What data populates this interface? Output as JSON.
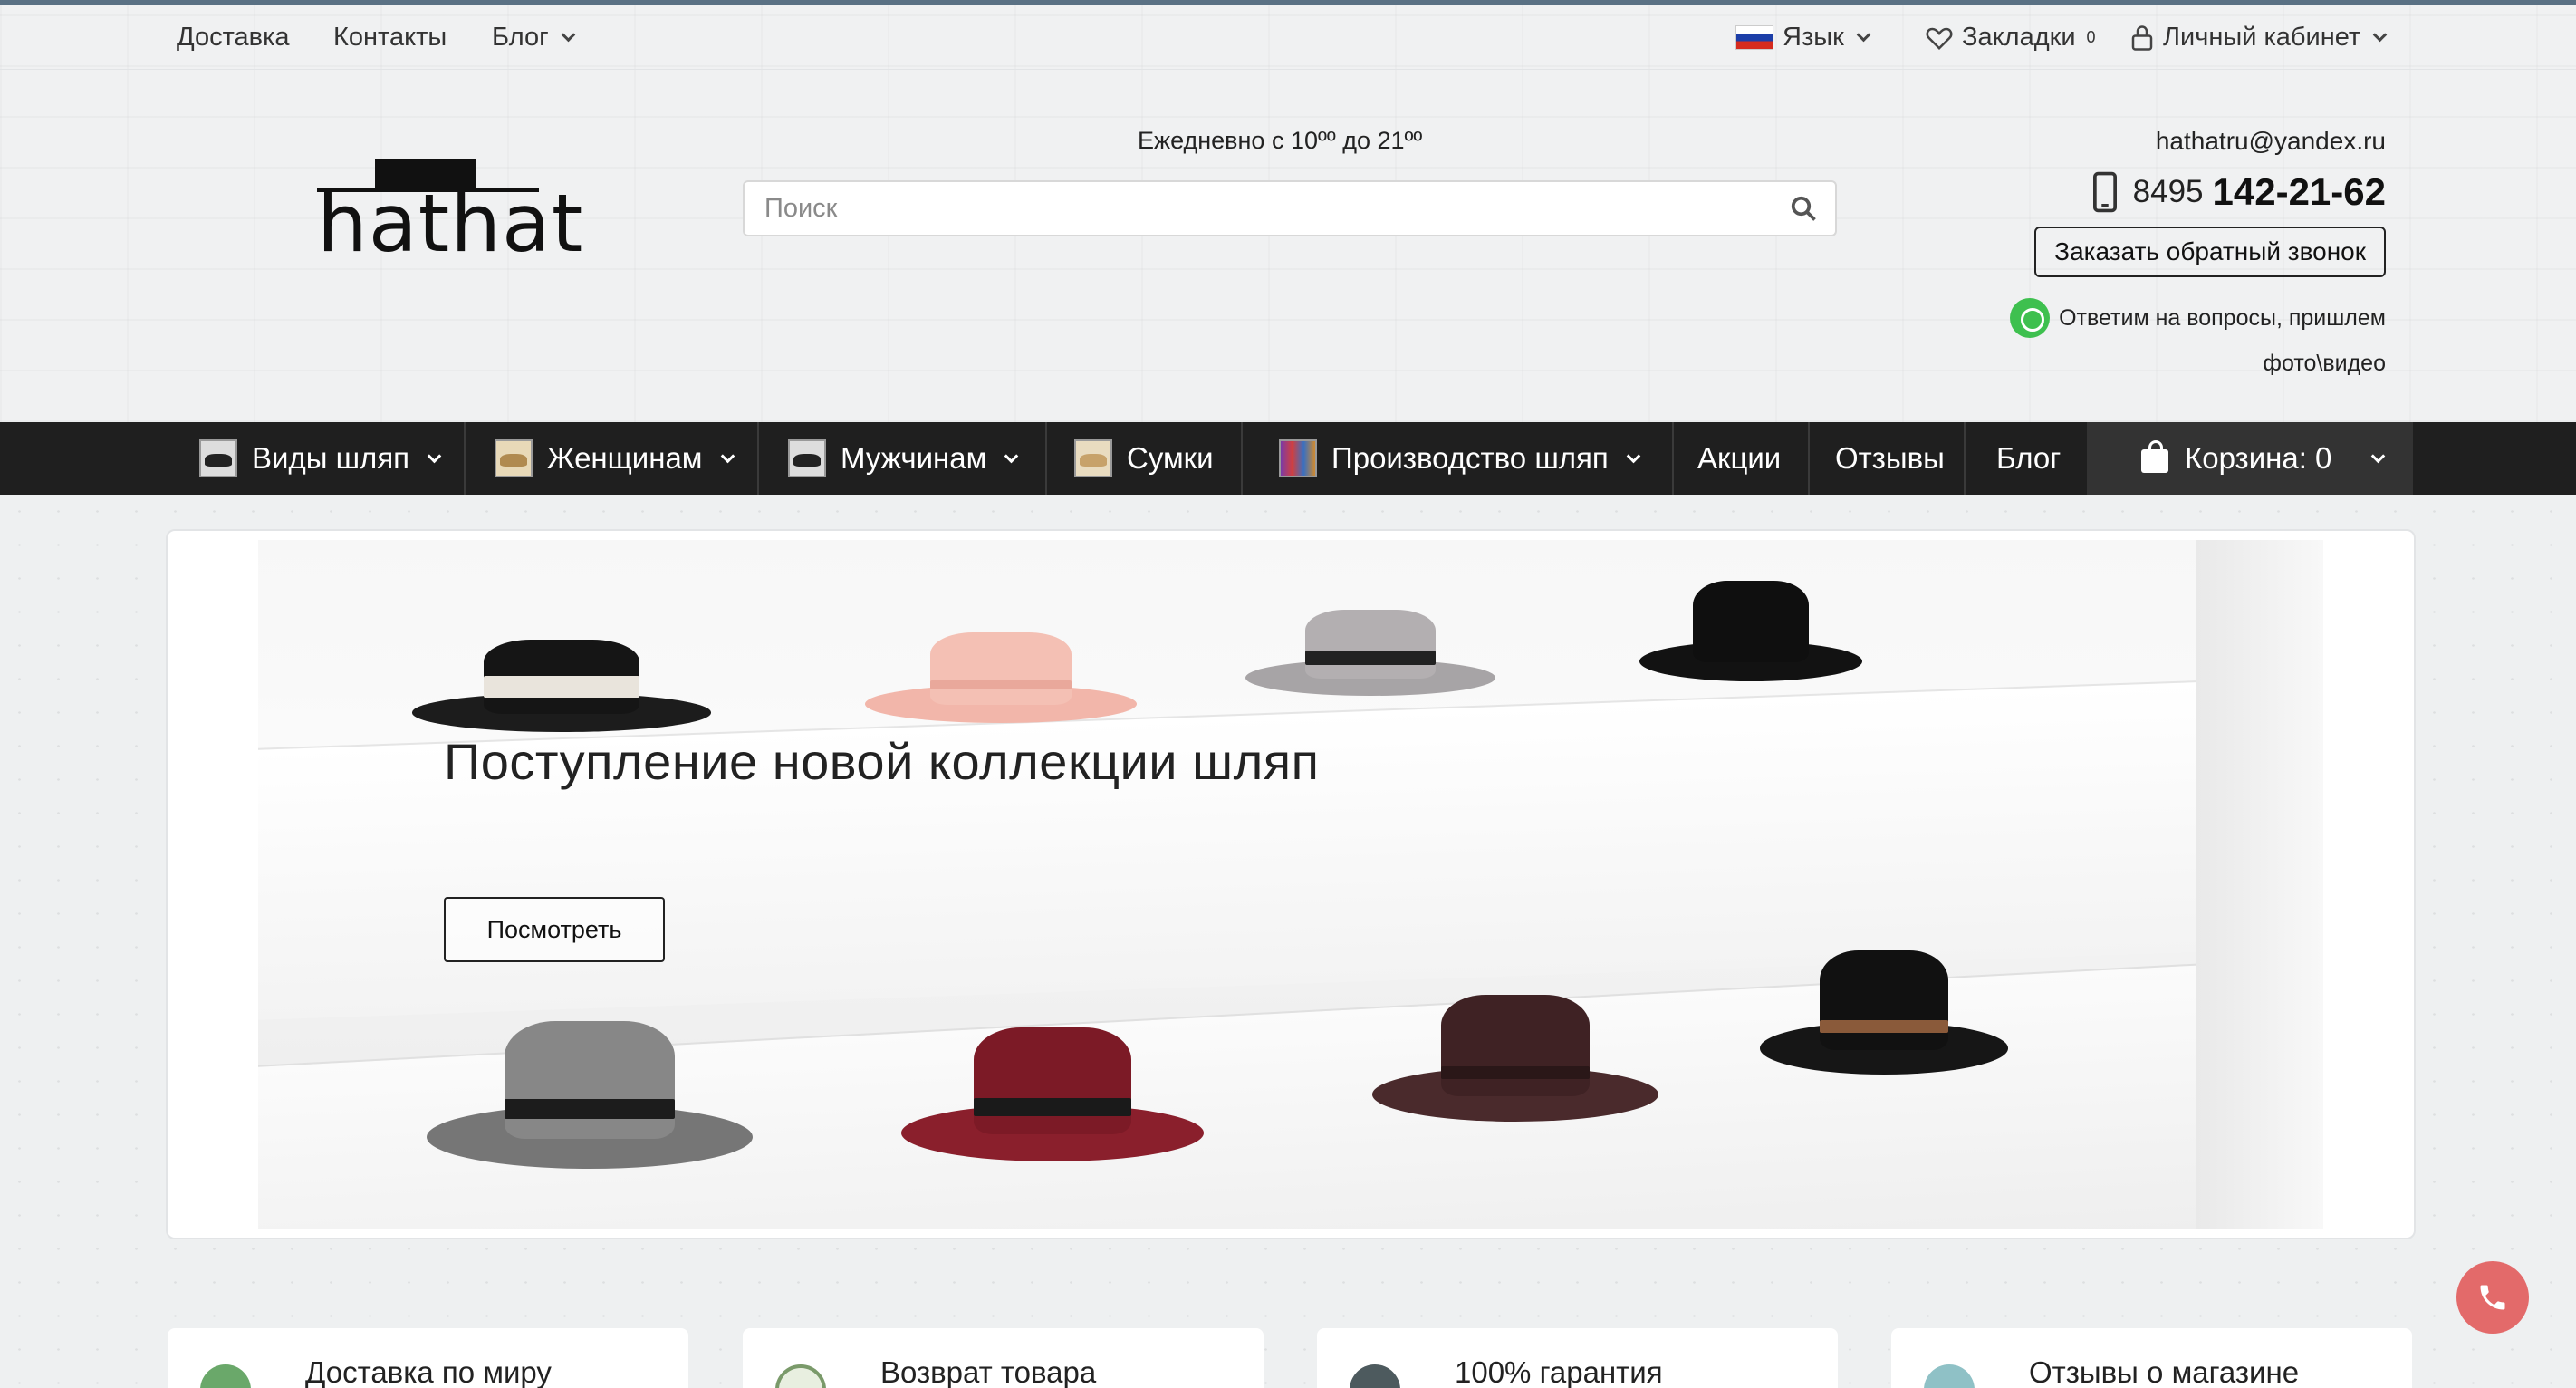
{
  "topbar": {
    "links": [
      {
        "label": "Доставка"
      },
      {
        "label": "Контакты"
      },
      {
        "label": "Блог"
      }
    ],
    "language_label": "Язык",
    "bookmarks_label": "Закладки",
    "bookmarks_count": "0",
    "account_label": "Личный кабинет"
  },
  "header": {
    "logo_text": "hathat",
    "hours": "Ежедневно с 10ºº до 21ºº",
    "search_placeholder": "Поиск",
    "email": "hathatru@yandex.ru",
    "phone_code": "8495",
    "phone_number": "142-21-62",
    "callback_label": "Заказать обратный звонок",
    "whatsapp_line1": "Ответим на вопросы, пришлем",
    "whatsapp_line2": "фото\\видео"
  },
  "nav": {
    "items": [
      {
        "label": "Виды шляп"
      },
      {
        "label": "Женщинам"
      },
      {
        "label": "Мужчинам"
      },
      {
        "label": "Сумки"
      },
      {
        "label": "Производство шляп"
      },
      {
        "label": "Акции"
      },
      {
        "label": "Отзывы"
      },
      {
        "label": "Блог"
      }
    ],
    "cart_label": "Корзина: 0"
  },
  "banner": {
    "title": "Поступление новой коллекции шляп",
    "button_label": "Посмотреть"
  },
  "features": [
    {
      "label": "Доставка по миру"
    },
    {
      "label": "Возврат товара"
    },
    {
      "label": "100% гарантия"
    },
    {
      "label": "Отзывы о магазине"
    }
  ],
  "colors": {
    "nav_bg": "#1f1f1f",
    "cart_bg": "#333333",
    "call_button": "#e36a6a",
    "whatsapp": "#3ec04f"
  }
}
